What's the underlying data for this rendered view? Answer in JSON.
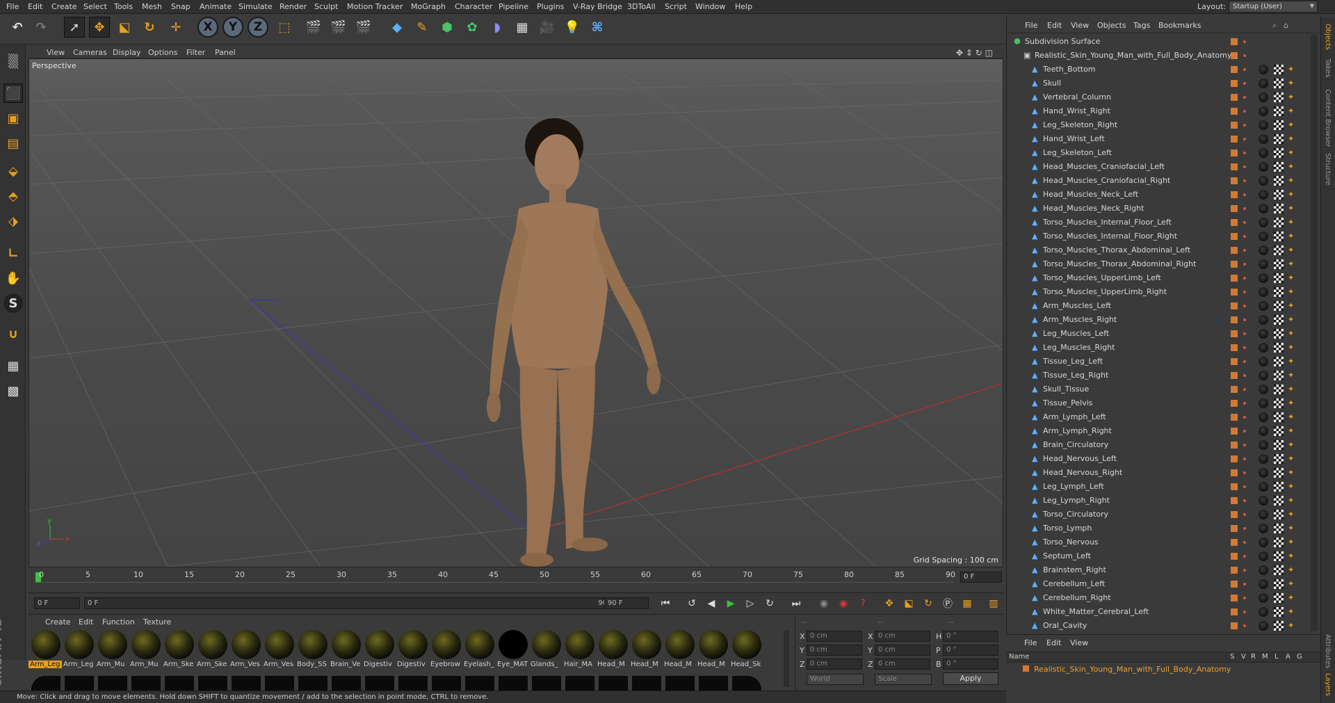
{
  "menubar": {
    "items": [
      "File",
      "Edit",
      "Create",
      "Select",
      "Tools",
      "Mesh",
      "Snap",
      "Animate",
      "Simulate",
      "Render",
      "Sculpt",
      "Motion Tracker",
      "MoGraph",
      "Character",
      "Pipeline",
      "Plugins",
      "V-Ray Bridge",
      "3DToAll",
      "Script",
      "Window",
      "Help"
    ],
    "layout_label": "Layout:",
    "layout_value": "Startup (User)"
  },
  "toolbar": {
    "axis_labels": [
      "X",
      "Y",
      "Z"
    ]
  },
  "viewport": {
    "menu": [
      "View",
      "Cameras",
      "Display",
      "Options",
      "Filter",
      "Panel"
    ],
    "label": "Perspective",
    "grid_spacing": "Grid Spacing : 100 cm",
    "axis_x": "x",
    "axis_y": "y",
    "axis_z": "z"
  },
  "timeline": {
    "ticks": [
      "0",
      "5",
      "10",
      "15",
      "20",
      "25",
      "30",
      "35",
      "40",
      "45",
      "50",
      "55",
      "60",
      "65",
      "70",
      "75",
      "80",
      "85",
      "90"
    ],
    "current_frame": "0 F"
  },
  "transport": {
    "start_field": "0 F",
    "range_start": "0 F",
    "range_end": "90 F",
    "end_field": "90 F"
  },
  "materials": {
    "menu": [
      "Create",
      "Edit",
      "Function",
      "Texture"
    ],
    "row1": [
      "Arm_Leg",
      "Arm_Leg",
      "Arm_Mu",
      "Arm_Mu",
      "Arm_Ske",
      "Arm_Ske",
      "Arm_Ves",
      "Arm_Ves",
      "Body_SS",
      "Brain_Ve",
      "Digestiv",
      "Digestiv",
      "Eyebrow",
      "Eyelash_",
      "Eye_MAT",
      "Glands_",
      "Hair_MA",
      "Head_M",
      "Head_M",
      "Head_M",
      "Head_M",
      "Head_Sk"
    ]
  },
  "coords": {
    "x_label": "X",
    "y_label": "Y",
    "z_label": "Z",
    "x2_label": "X",
    "y2_label": "Y",
    "z2_label": "Z",
    "h_label": "H",
    "p_label": "P",
    "b_label": "B",
    "pos_x": "0 cm",
    "pos_y": "0 cm",
    "pos_z": "0 cm",
    "size_x": "0 cm",
    "size_y": "0 cm",
    "size_z": "0 cm",
    "rot_h": "0 °",
    "rot_p": "0 °",
    "rot_b": "0 °",
    "header_left": "--",
    "header_mid": "--",
    "header_right": "--",
    "world": "World",
    "scale": "Scale",
    "apply": "Apply"
  },
  "status": {
    "text": "Move: Click and drag to move elements. Hold down SHIFT to quantize movement / add to the selection in point mode, CTRL to remove."
  },
  "objects": {
    "menu": [
      "File",
      "Edit",
      "View",
      "Objects",
      "Tags",
      "Bookmarks"
    ],
    "root": "Subdivision Surface",
    "parent": "Realistic_Skin_Young_Man_with_Full_Body_Anatomy",
    "children": [
      "Teeth_Bottom",
      "Skull",
      "Vertebral_Column",
      "Hand_Wrist_Right",
      "Leg_Skeleton_Right",
      "Hand_Wrist_Left",
      "Leg_Skeleton_Left",
      "Head_Muscles_Craniofacial_Left",
      "Head_Muscles_Craniofacial_Right",
      "Head_Muscles_Neck_Left",
      "Head_Muscles_Neck_Right",
      "Torso_Muscles_Internal_Floor_Left",
      "Torso_Muscles_Internal_Floor_Right",
      "Torso_Muscles_Thorax_Abdominal_Left",
      "Torso_Muscles_Thorax_Abdominal_Right",
      "Torso_Muscles_UpperLimb_Left",
      "Torso_Muscles_UpperLimb_Right",
      "Arm_Muscles_Left",
      "Arm_Muscles_Right",
      "Leg_Muscles_Left",
      "Leg_Muscles_Right",
      "Tissue_Leg_Left",
      "Tissue_Leg_Right",
      "Skull_Tissue",
      "Tissue_Pelvis",
      "Arm_Lymph_Left",
      "Arm_Lymph_Right",
      "Brain_Circulatory",
      "Head_Nervous_Left",
      "Head_Nervous_Right",
      "Leg_Lymph_Left",
      "Leg_Lymph_Right",
      "Torso_Circulatory",
      "Torso_Lymph",
      "Torso_Nervous",
      "Septum_Left",
      "Brainstem_Right",
      "Cerebellum_Left",
      "Cerebellum_Right",
      "White_Matter_Cerebral_Left",
      "Oral_Cavity"
    ]
  },
  "side_tabs": [
    "Objects",
    "Takes",
    "Content Browser",
    "Structure"
  ],
  "side_tabs_lower": [
    "Attributes",
    "Layers"
  ],
  "layers": {
    "menu": [
      "File",
      "Edit",
      "View"
    ],
    "header_name": "Name",
    "header_cols": [
      "S",
      "V",
      "R",
      "M",
      "L",
      "A",
      "G"
    ],
    "row_name": "Realistic_Skin_Young_Man_with_Full_Body_Anatomy"
  },
  "colors": {
    "accent": "#e8a020",
    "selection": "#f0a030",
    "object_icon": "#5db0ff"
  }
}
